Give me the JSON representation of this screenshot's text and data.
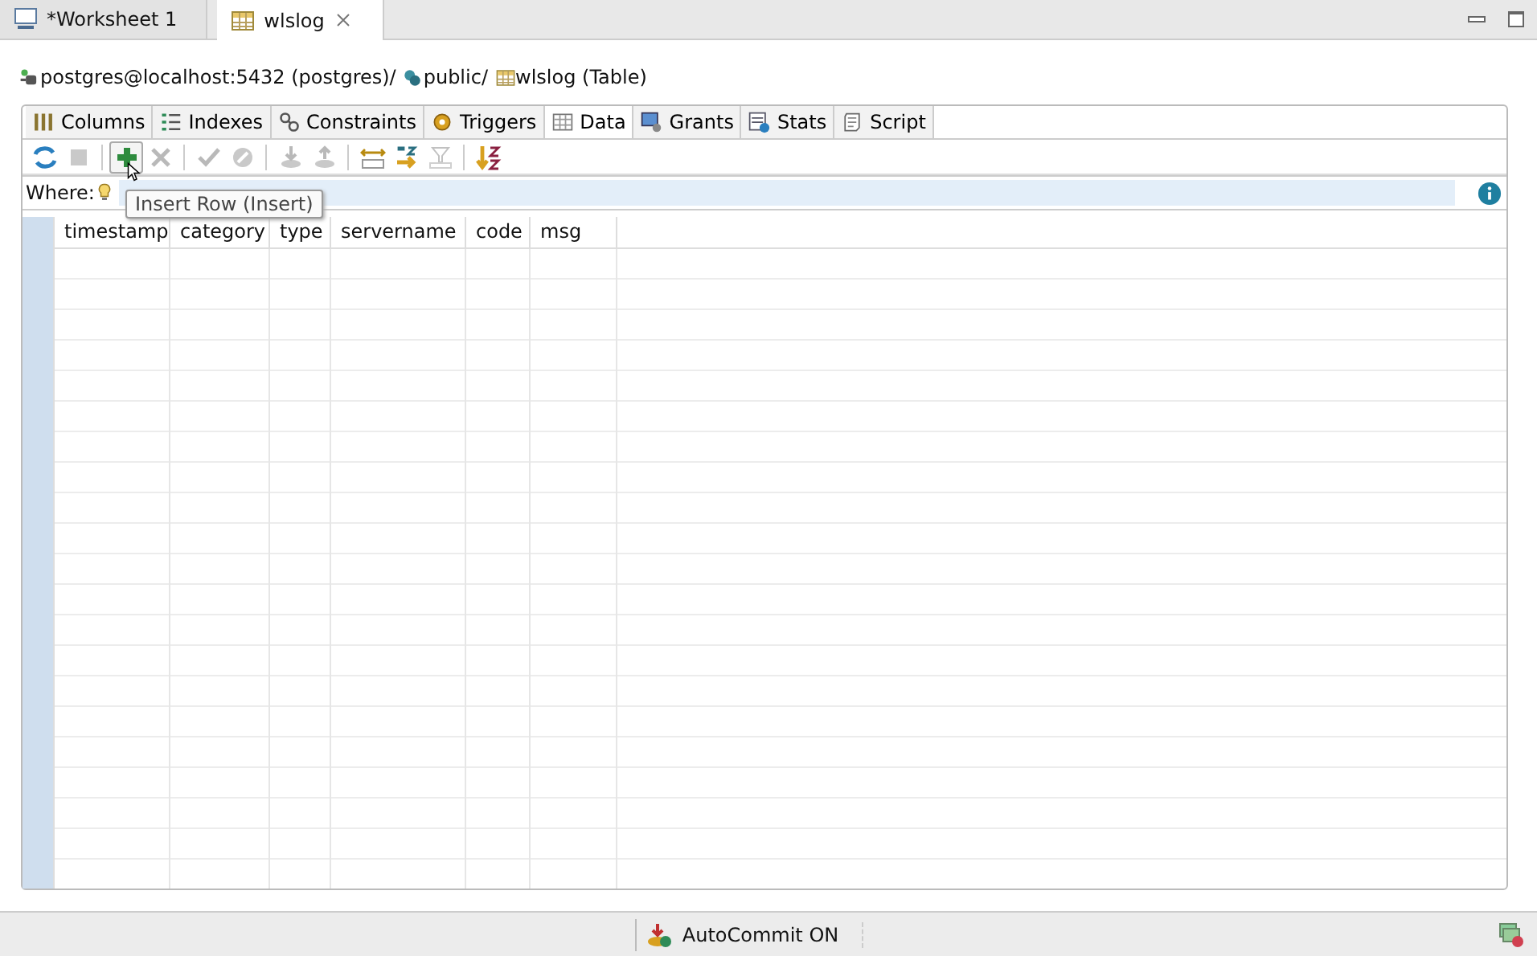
{
  "editor_tabs": [
    {
      "label": "*Worksheet 1",
      "kind": "sql",
      "selected": false
    },
    {
      "label": "wlslog",
      "kind": "table",
      "selected": true
    }
  ],
  "breadcrumb": [
    {
      "label": "postgres@localhost:5432 (postgres)",
      "kind": "connection",
      "sep": "/"
    },
    {
      "label": "public",
      "kind": "schema",
      "sep": "/"
    },
    {
      "label": "wlslog (Table)",
      "kind": "table"
    }
  ],
  "object_tabs": [
    {
      "label": "Columns",
      "kind": "columns",
      "selected": false
    },
    {
      "label": "Indexes",
      "kind": "indexes",
      "selected": false
    },
    {
      "label": "Constraints",
      "kind": "constraints",
      "selected": false
    },
    {
      "label": "Triggers",
      "kind": "triggers",
      "selected": false
    },
    {
      "label": "Data",
      "kind": "data",
      "selected": true
    },
    {
      "label": "Grants",
      "kind": "grants",
      "selected": false
    },
    {
      "label": "Stats",
      "kind": "stats",
      "selected": false
    },
    {
      "label": "Script",
      "kind": "script",
      "selected": false
    }
  ],
  "toolbar": [
    {
      "kind": "refresh",
      "disabled": false,
      "hovered": false
    },
    {
      "kind": "stop",
      "disabled": true,
      "hovered": false
    },
    {
      "kind": "separator"
    },
    {
      "kind": "insert",
      "disabled": false,
      "hovered": true
    },
    {
      "kind": "delete",
      "disabled": true,
      "hovered": false
    },
    {
      "kind": "separator"
    },
    {
      "kind": "commit",
      "disabled": true,
      "hovered": false
    },
    {
      "kind": "cancel",
      "disabled": true,
      "hovered": false
    },
    {
      "kind": "separator"
    },
    {
      "kind": "import",
      "disabled": true,
      "hovered": false
    },
    {
      "kind": "export",
      "disabled": true,
      "hovered": false
    },
    {
      "kind": "separator"
    },
    {
      "kind": "fit",
      "disabled": false,
      "hovered": false
    },
    {
      "kind": "sort",
      "disabled": false,
      "hovered": false
    },
    {
      "kind": "filter",
      "disabled": true,
      "hovered": false
    },
    {
      "kind": "separator"
    },
    {
      "kind": "order",
      "disabled": false,
      "hovered": false
    }
  ],
  "tooltip": "Insert Row (Insert)",
  "where": {
    "label": "Where:"
  },
  "table": {
    "columns": [
      "timestamp",
      "category",
      "type",
      "servername",
      "code",
      "msg"
    ]
  },
  "status_bar": {
    "autocommit": "AutoCommit ON"
  }
}
